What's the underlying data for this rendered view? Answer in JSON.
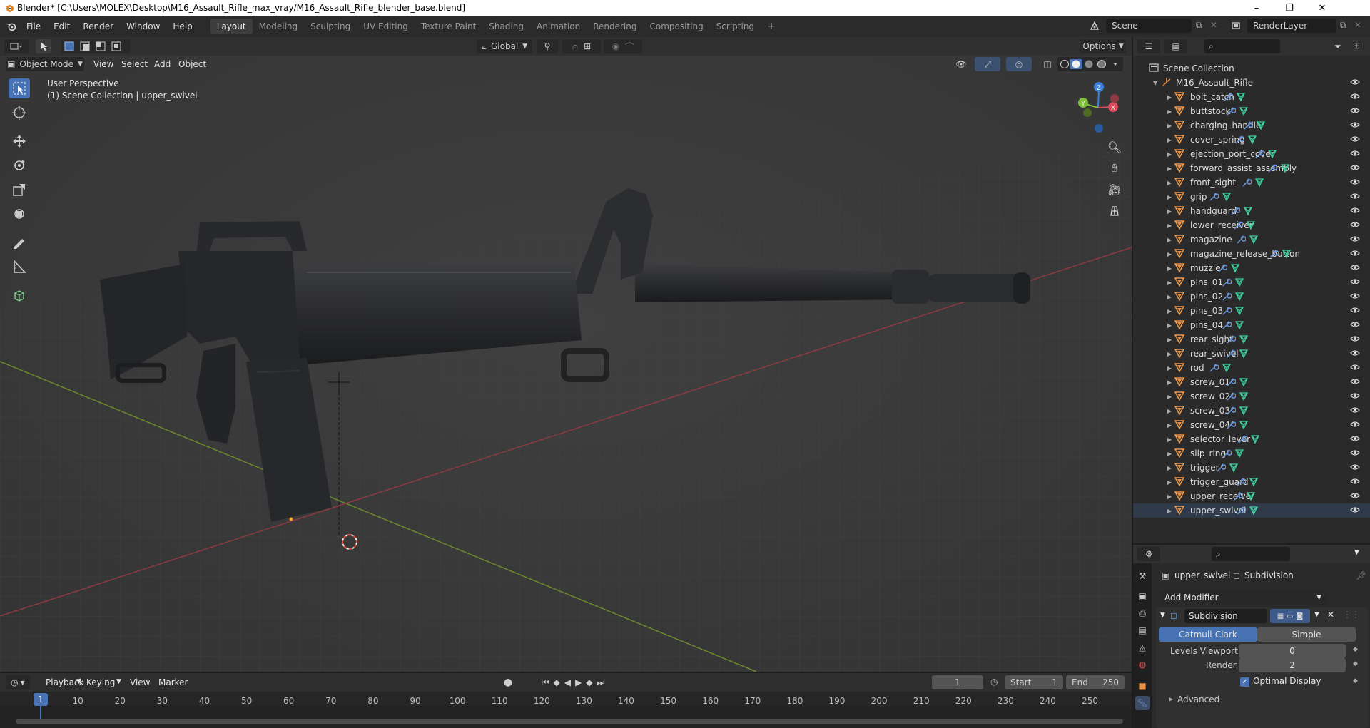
{
  "titlebar": {
    "title": "Blender* [C:\\Users\\MOLEX\\Desktop\\M16_Assault_Rifle_max_vray/M16_Assault_Rifle_blender_base.blend]",
    "minimize": "–",
    "maximize": "❐",
    "close": "✕"
  },
  "menubar": {
    "menus": [
      "File",
      "Edit",
      "Render",
      "Window",
      "Help"
    ],
    "workspaces": [
      "Layout",
      "Modeling",
      "Sculpting",
      "UV Editing",
      "Texture Paint",
      "Shading",
      "Animation",
      "Rendering",
      "Compositing",
      "Scripting"
    ],
    "active_workspace": "Layout",
    "add_workspace": "+",
    "scene_name": "Scene",
    "view_layer": "RenderLayer"
  },
  "viewport_header": {
    "transform_orientation": "Global",
    "options_label": "Options",
    "mode": "Object Mode",
    "menus": [
      "View",
      "Select",
      "Add",
      "Object"
    ]
  },
  "viewport_overlay": {
    "perspective": "User Perspective",
    "collection_info": "(1) Scene Collection | upper_swivel"
  },
  "gizmo": {
    "x": "X",
    "y": "Y",
    "z": "Z"
  },
  "timeline": {
    "menus": [
      "Playback",
      "Keying",
      "View",
      "Marker"
    ],
    "current_frame": "1",
    "start_label": "Start",
    "start_value": "1",
    "end_label": "End",
    "end_value": "250",
    "ticks": [
      "1",
      "10",
      "20",
      "30",
      "40",
      "50",
      "60",
      "70",
      "80",
      "90",
      "100",
      "110",
      "120",
      "130",
      "140",
      "150",
      "160",
      "170",
      "180",
      "190",
      "200",
      "210",
      "220",
      "230",
      "240",
      "250"
    ]
  },
  "outliner": {
    "root": "Scene Collection",
    "collection": "M16_Assault_Rifle",
    "objects": [
      "bolt_catch",
      "buttstock",
      "charging_handle",
      "cover_spring",
      "ejection_port_cover",
      "forward_assist_assembly",
      "front_sight",
      "grip",
      "handguard",
      "lower_receiver",
      "magazine",
      "magazine_release_button",
      "muzzle",
      "pins_01",
      "pins_02",
      "pins_03",
      "pins_04",
      "rear_sight",
      "rear_swivel",
      "rod",
      "screw_01",
      "screw_02",
      "screw_03",
      "screw_04",
      "selector_lever",
      "slip_ring",
      "trigger",
      "trigger_guard",
      "upper_receiver",
      "upper_swivel"
    ],
    "selected": "upper_swivel"
  },
  "properties": {
    "object_name": "upper_swivel",
    "modifier_context": "Subdivision",
    "add_modifier": "Add Modifier",
    "modifier_name": "Subdivision",
    "type_options": [
      "Catmull-Clark",
      "Simple"
    ],
    "active_type": "Catmull-Clark",
    "levels_viewport_label": "Levels Viewport",
    "levels_viewport_value": "0",
    "render_label": "Render",
    "render_value": "2",
    "optimal_display_label": "Optimal Display",
    "optimal_display_checked": true,
    "advanced_label": "Advanced"
  },
  "colors": {
    "accent": "#4772b3",
    "object_orange": "#e8954a",
    "modifier_blue": "#6d9be0",
    "mesh_green": "#3fd1a1",
    "axis_x": "#e04a5a",
    "axis_y": "#7fbf3a",
    "axis_z": "#3a82e0"
  }
}
